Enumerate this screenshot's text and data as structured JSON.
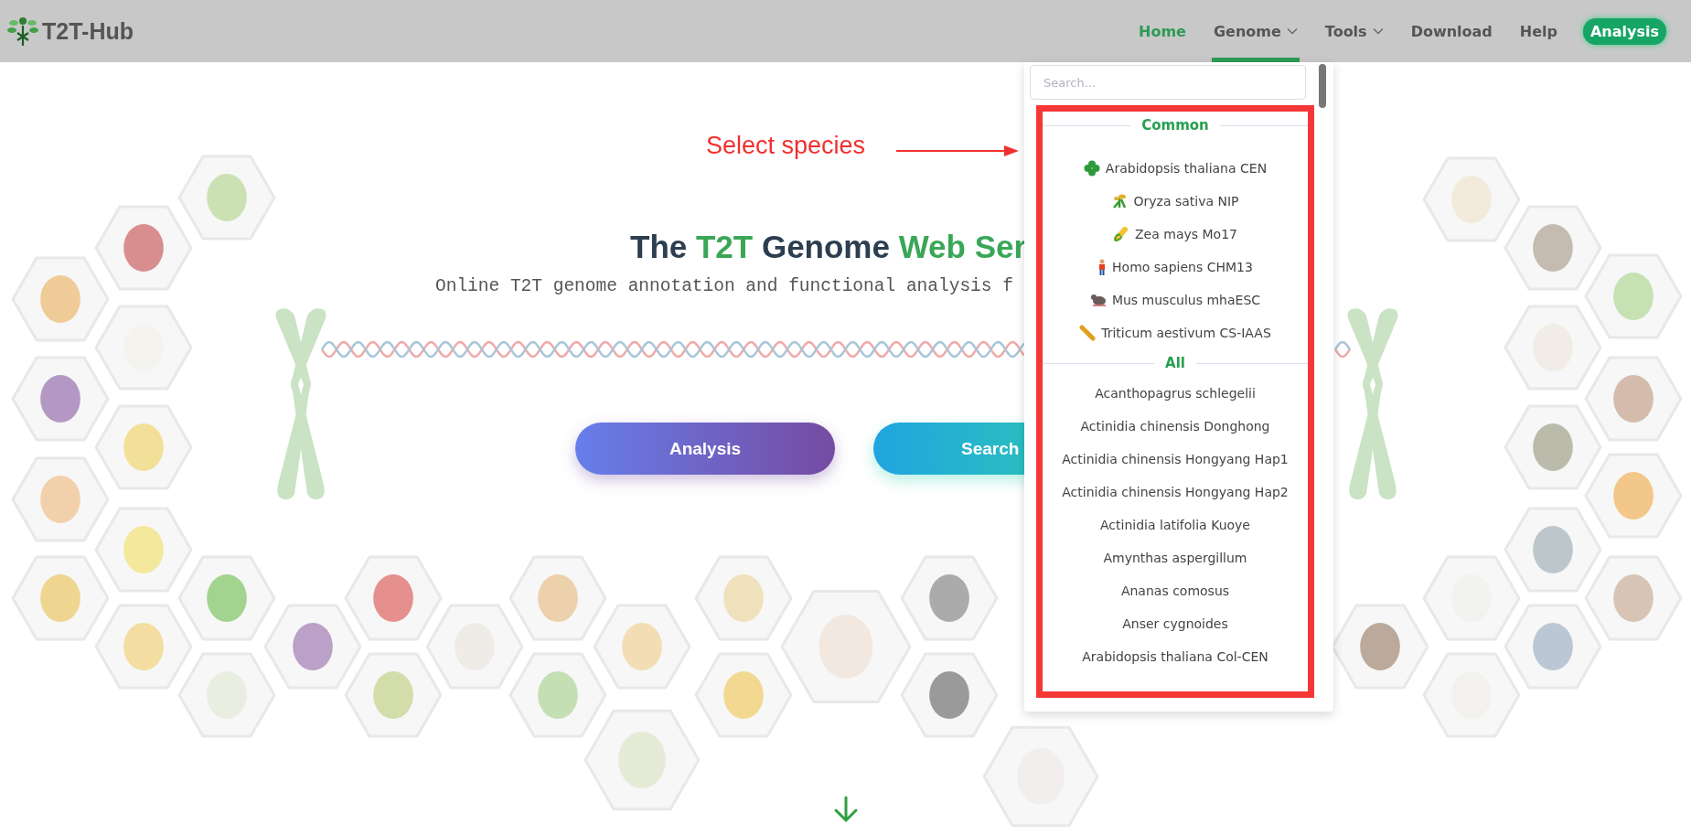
{
  "brand": {
    "name": "T2T-Hub"
  },
  "nav": [
    {
      "label": "Home",
      "kind": "link",
      "selected": true,
      "expanded": false
    },
    {
      "label": "Genome",
      "kind": "menu",
      "selected": false,
      "expanded": true
    },
    {
      "label": "Tools",
      "kind": "menu",
      "selected": false,
      "expanded": false
    },
    {
      "label": "Download",
      "kind": "link",
      "selected": false,
      "expanded": false
    },
    {
      "label": "Help",
      "kind": "link",
      "selected": false,
      "expanded": false
    },
    {
      "label": "Analysis",
      "kind": "button",
      "selected": false,
      "expanded": false
    }
  ],
  "hero": {
    "title": [
      {
        "text": "The ",
        "highlight": false
      },
      {
        "text": "T2T",
        "highlight": true
      },
      {
        "text": " Genome ",
        "highlight": false
      },
      {
        "text": "Web Ser",
        "highlight": true
      }
    ],
    "subtitle": "Online T2T genome annotation and functional analysis f",
    "buttons": [
      {
        "label": "Analysis",
        "kind": "analysis"
      },
      {
        "label": "Search",
        "kind": "search"
      }
    ]
  },
  "annotation": {
    "text": "Select species"
  },
  "species_dropdown": {
    "search": {
      "placeholder": "Search..."
    },
    "sections": [
      {
        "title": "Common",
        "items": [
          {
            "label": "Arabidopsis thaliana CEN",
            "kind": "clover"
          },
          {
            "label": "Oryza sativa NIP",
            "kind": "rice"
          },
          {
            "label": "Zea mays Mo17",
            "kind": "corn"
          },
          {
            "label": "Homo sapiens CHM13",
            "kind": "person"
          },
          {
            "label": "Mus musculus mhaESC",
            "kind": "mouse"
          },
          {
            "label": "Triticum aestivum CS-IAAS",
            "kind": "stick"
          }
        ]
      },
      {
        "title": "All",
        "items": [
          {
            "label": "Acanthopagrus schlegelii",
            "kind": "plain"
          },
          {
            "label": "Actinidia chinensis Donghong",
            "kind": "plain"
          },
          {
            "label": "Actinidia chinensis Hongyang Hap1",
            "kind": "plain"
          },
          {
            "label": "Actinidia chinensis Hongyang Hap2",
            "kind": "plain"
          },
          {
            "label": "Actinidia latifolia Kuoye",
            "kind": "plain"
          },
          {
            "label": "Amynthas aspergillum",
            "kind": "plain"
          },
          {
            "label": "Ananas comosus",
            "kind": "plain"
          },
          {
            "label": "Anser cygnoides",
            "kind": "plain"
          },
          {
            "label": "Arabidopsis thaliana Col-CEN",
            "kind": "plain"
          }
        ]
      }
    ]
  }
}
